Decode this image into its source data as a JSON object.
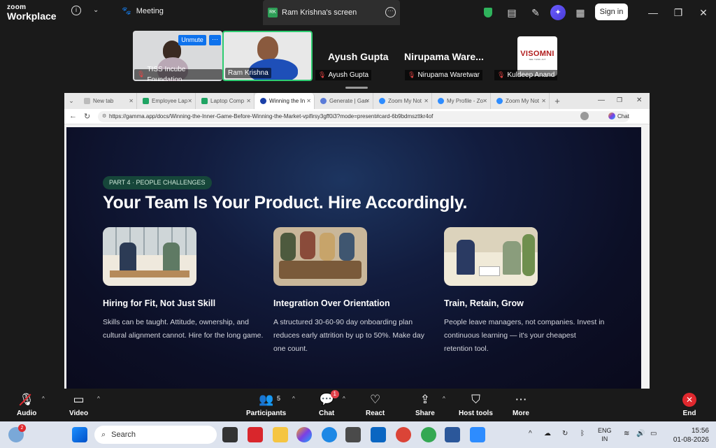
{
  "zoom": {
    "brand_line1": "zoom",
    "brand_line2": "Workplace",
    "meeting_label": "Meeting",
    "screen_initials": "RK",
    "screen_label": "Ram Krishna's screen",
    "signin_label": "Sign in",
    "accent_color": "#0e72ed"
  },
  "participants": {
    "unmute_label": "Unmute",
    "tiles": [
      {
        "name": "TISS Incube Foundation"
      },
      {
        "name": "Ram Krishna"
      },
      {
        "display": "Ayush Gupta",
        "name": "Ayush Gupta"
      },
      {
        "display": "Nirupama  Ware...",
        "name": "Nirupama Waretwar"
      },
      {
        "name": "Kuldeep Anand",
        "logo_text": "VISOMNI",
        "logo_sub": "SEE. THINK. ACT"
      }
    ]
  },
  "browser": {
    "tabs": [
      {
        "label": "New tab",
        "icon": "page-icon"
      },
      {
        "label": "Employee Lap",
        "icon": "sheets-icon"
      },
      {
        "label": "Laptop Comp",
        "icon": "sheets-icon"
      },
      {
        "label": "Winning the In",
        "icon": "gamma-icon",
        "active": true
      },
      {
        "label": "Generate | Gan",
        "icon": "gamma-icon"
      },
      {
        "label": "Zoom My Not",
        "icon": "zoom-icon"
      },
      {
        "label": "My Profile - Zo",
        "icon": "zoom-icon"
      },
      {
        "label": "Zoom My Not",
        "icon": "zoom-icon"
      }
    ],
    "url": "https://gamma.app/docs/Winning-the-Inner-Game-Before-Winning-the-Market-vpifirsy3gff0i3?mode=present#card-6b9bdmszttkr4of",
    "chat_label": "Chat"
  },
  "slide": {
    "badge": "PART 4 · PEOPLE CHALLENGES",
    "headline": "Your Team Is Your Product. Hire Accordingly.",
    "cards": [
      {
        "title": "Hiring for Fit, Not Just Skill",
        "body": "Skills can be taught. Attitude, ownership, and cultural alignment cannot. Hire for the long game."
      },
      {
        "title": "Integration Over Orientation",
        "body": "A structured 30-60-90 day onboarding plan reduces early attrition by up to 50%. Make day one count."
      },
      {
        "title": "Train, Retain, Grow",
        "body": "People leave managers, not companies. Invest in continuous learning — it's your cheapest retention tool."
      }
    ]
  },
  "controls": {
    "audio": "Audio",
    "video": "Video",
    "participants": "Participants",
    "participants_count": "5",
    "chat": "Chat",
    "chat_badge": "1",
    "react": "React",
    "share": "Share",
    "host_tools": "Host tools",
    "more": "More",
    "end": "End"
  },
  "taskbar": {
    "weather_badge": "2",
    "search_placeholder": "Search",
    "lang_line1": "ENG",
    "lang_line2": "IN",
    "time": "15:56",
    "date": "01-08-2026"
  }
}
